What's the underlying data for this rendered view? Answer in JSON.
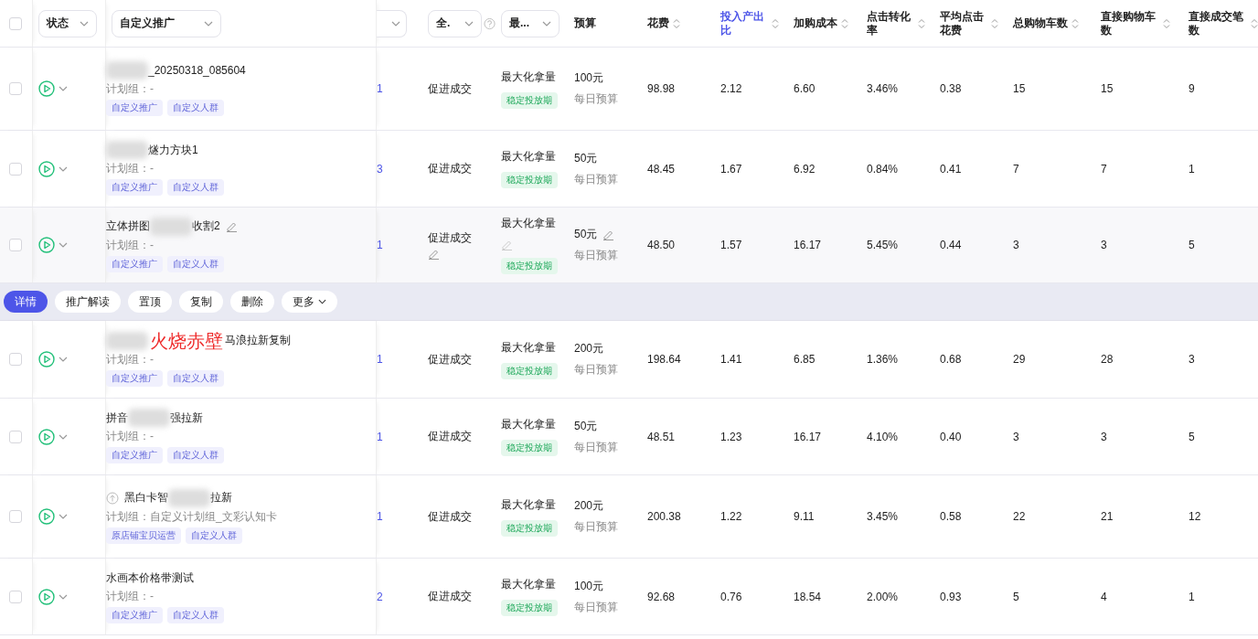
{
  "header": {
    "select_all": {
      "checked": false
    },
    "filters": [
      {
        "label": "状态"
      },
      {
        "label": "自定义推广"
      }
    ],
    "goal_filter": {
      "label": "全."
    },
    "strategy_filter": {
      "label": "最..."
    },
    "budget": "预算",
    "metrics": [
      {
        "label": "花费",
        "active": false
      },
      {
        "label": "投入产出比",
        "active": true
      },
      {
        "label": "加购成本",
        "active": false
      },
      {
        "label": "点击转化率",
        "active": false
      },
      {
        "label": "平均点击花费",
        "active": false
      },
      {
        "label": "总购物车数",
        "active": false
      },
      {
        "label": "直接购物车数",
        "active": false
      },
      {
        "label": "直接成交笔数",
        "active": false
      }
    ]
  },
  "rows": [
    {
      "checked": false,
      "hovered": false,
      "name": [
        {
          "kind": "blur"
        },
        {
          "kind": "text",
          "text": "_20250318_085604"
        }
      ],
      "group": "计划组：-",
      "tags": [
        "自定义推广",
        "自定义人群"
      ],
      "column_3": "1",
      "goal": "促进成交",
      "strategy": "最大化拿量",
      "phase": "稳定投放期",
      "budget": "100元",
      "budget_type": "每日预算",
      "values": [
        "98.98",
        "2.12",
        "6.60",
        "3.46%",
        "0.38",
        "15",
        "15",
        "9"
      ]
    },
    {
      "checked": false,
      "hovered": false,
      "name": [
        {
          "kind": "blur"
        },
        {
          "kind": "text",
          "text": "燧力方块1"
        }
      ],
      "group": "计划组：-",
      "tags": [
        "自定义推广",
        "自定义人群"
      ],
      "column_3": "3",
      "goal": "促进成交",
      "strategy": "最大化拿量",
      "phase": "稳定投放期",
      "budget": "50元",
      "budget_type": "每日预算",
      "values": [
        "48.45",
        "1.67",
        "6.92",
        "0.84%",
        "0.41",
        "7",
        "7",
        "1"
      ]
    },
    {
      "checked": false,
      "hovered": true,
      "name": [
        {
          "kind": "text",
          "text": "立体拼图"
        },
        {
          "kind": "blur"
        },
        {
          "kind": "text",
          "text": "收割2"
        }
      ],
      "group": "计划组：-",
      "tags": [
        "自定义推广",
        "自定义人群"
      ],
      "column_3": "1",
      "goal": "促进成交",
      "strategy": "最大化拿量",
      "phase": "稳定投放期",
      "budget": "50元",
      "budget_type": "每日预算",
      "values": [
        "48.50",
        "1.57",
        "16.17",
        "5.45%",
        "0.44",
        "3",
        "3",
        "5"
      ],
      "actions": [
        {
          "label": "详情",
          "selected": true,
          "caret": false
        },
        {
          "label": "推广解读",
          "selected": false,
          "caret": false
        },
        {
          "label": "置顶",
          "selected": false,
          "caret": false
        },
        {
          "label": "复制",
          "selected": false,
          "caret": false
        },
        {
          "label": "删除",
          "selected": false,
          "caret": false
        },
        {
          "label": "更多",
          "selected": false,
          "caret": true
        }
      ]
    },
    {
      "checked": false,
      "hovered": false,
      "name": [
        {
          "kind": "blur"
        },
        {
          "kind": "text",
          "text": "马浪拉新复制"
        }
      ],
      "annotation": "火烧赤壁",
      "group": "计划组：-",
      "tags": [
        "自定义推广",
        "自定义人群"
      ],
      "column_3": "1",
      "goal": "促进成交",
      "strategy": "最大化拿量",
      "phase": "稳定投放期",
      "budget": "200元",
      "budget_type": "每日预算",
      "values": [
        "198.64",
        "1.41",
        "6.85",
        "1.36%",
        "0.68",
        "29",
        "28",
        "3"
      ]
    },
    {
      "checked": false,
      "hovered": false,
      "name": [
        {
          "kind": "text",
          "text": "拼音"
        },
        {
          "kind": "blur"
        },
        {
          "kind": "text",
          "text": "强拉新"
        }
      ],
      "group": "计划组：-",
      "tags": [
        "自定义推广",
        "自定义人群"
      ],
      "column_3": "1",
      "goal": "促进成交",
      "strategy": "最大化拿量",
      "phase": "稳定投放期",
      "budget": "50元",
      "budget_type": "每日预算",
      "values": [
        "48.51",
        "1.23",
        "16.17",
        "4.10%",
        "0.40",
        "3",
        "3",
        "5"
      ]
    },
    {
      "checked": false,
      "hovered": false,
      "pinned_icon": true,
      "name": [
        {
          "kind": "text",
          "text": "黑白卡智"
        },
        {
          "kind": "blur"
        },
        {
          "kind": "text",
          "text": "拉新"
        }
      ],
      "group": "计划组：自定义计划组_文彩认知卡",
      "tags": [
        "原店铺宝贝运营",
        "自定义人群"
      ],
      "column_3": "1",
      "goal": "促进成交",
      "strategy": "最大化拿量",
      "phase": "稳定投放期",
      "budget": "200元",
      "budget_type": "每日预算",
      "values": [
        "200.38",
        "1.22",
        "9.11",
        "3.45%",
        "0.58",
        "22",
        "21",
        "12"
      ]
    },
    {
      "checked": false,
      "hovered": false,
      "name": [
        {
          "kind": "text",
          "text": "水画本价格带测试"
        }
      ],
      "group": "计划组：-",
      "tags": [
        "自定义推广",
        "自定义人群"
      ],
      "column_3": "2",
      "goal": "促进成交",
      "strategy": "最大化拿量",
      "phase": "稳定投放期",
      "budget": "100元",
      "budget_type": "每日预算",
      "values": [
        "92.68",
        "0.76",
        "18.54",
        "2.00%",
        "0.93",
        "5",
        "4",
        "1"
      ]
    }
  ]
}
